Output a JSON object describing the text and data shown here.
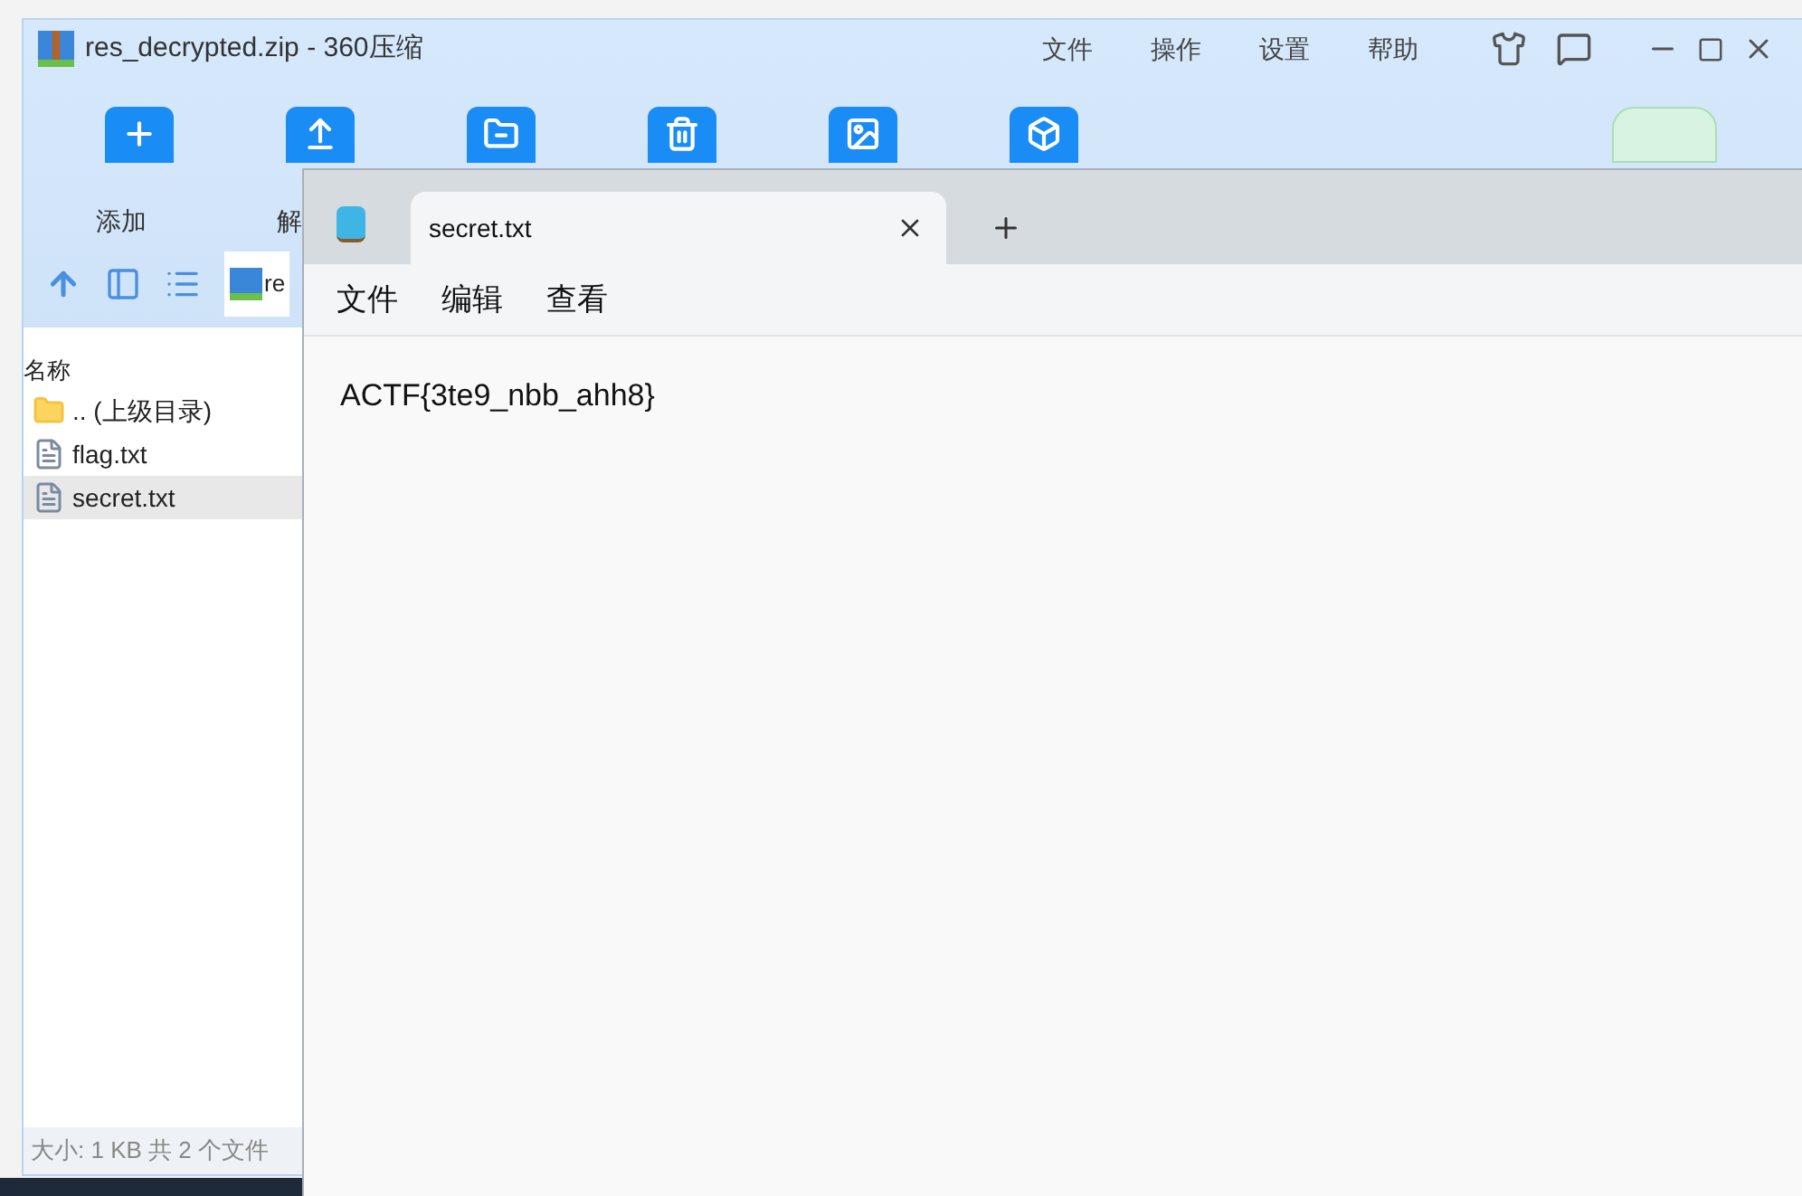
{
  "archive_window": {
    "title": "res_decrypted.zip - 360压缩",
    "menu": [
      "文件",
      "操作",
      "设置",
      "帮助"
    ],
    "toolbar": [
      {
        "kind": "add",
        "label": "添加"
      },
      {
        "kind": "extract",
        "label": "解"
      },
      {
        "kind": "folder"
      },
      {
        "kind": "recycle"
      },
      {
        "kind": "image"
      },
      {
        "kind": "cube"
      }
    ],
    "path": "re",
    "column_header": "名称",
    "files": [
      {
        "kind": "parent",
        "name": ".. (上级目录)",
        "selected": false
      },
      {
        "kind": "text",
        "name": "flag.txt",
        "selected": false
      },
      {
        "kind": "text",
        "name": "secret.txt",
        "selected": true
      }
    ],
    "status": "大小: 1 KB 共 2 个文件"
  },
  "notepad": {
    "tabs": [
      {
        "label": "secret.txt",
        "selected": true
      }
    ],
    "menu": [
      "文件",
      "编辑",
      "查看"
    ],
    "content": "ACTF{3te9_nbb_ahh8}"
  }
}
